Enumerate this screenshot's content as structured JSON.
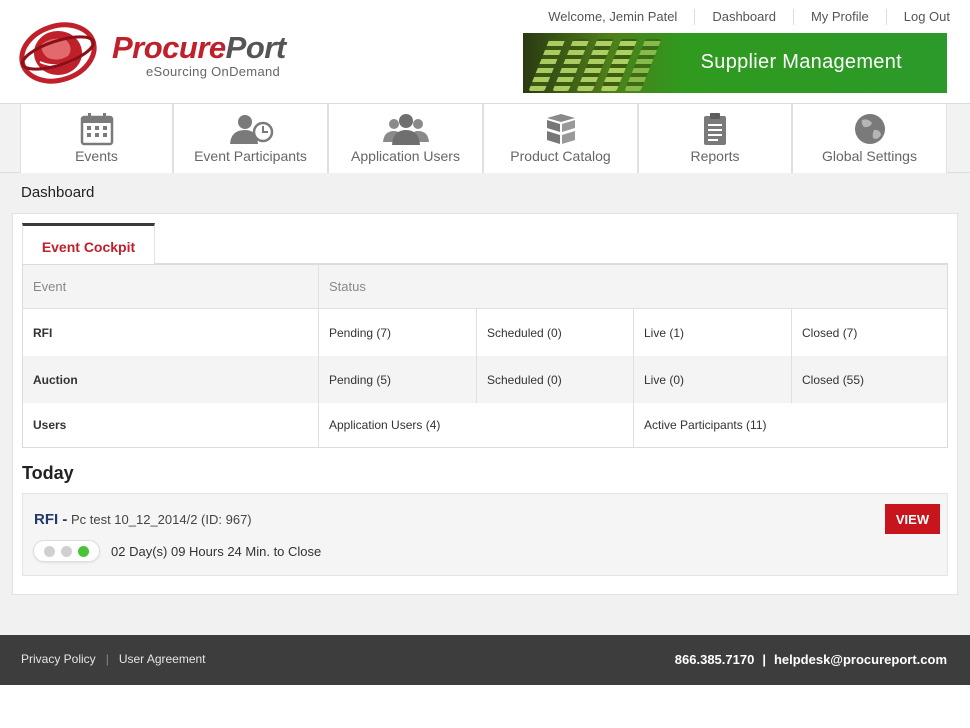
{
  "brand": {
    "name_part1": "Procure",
    "name_part2": "Port",
    "tagline": "eSourcing OnDemand",
    "accent": "#c0202a"
  },
  "top_links": {
    "welcome": "Welcome, Jemin Patel",
    "dashboard": "Dashboard",
    "my_profile": "My Profile",
    "log_out": "Log Out"
  },
  "banner": {
    "text": "Supplier Management"
  },
  "nav": [
    {
      "label": "Events",
      "icon": "calendar-icon"
    },
    {
      "label": "Event Participants",
      "icon": "participants-clock-icon"
    },
    {
      "label": "Application Users",
      "icon": "users-group-icon"
    },
    {
      "label": "Product Catalog",
      "icon": "boxes-icon"
    },
    {
      "label": "Reports",
      "icon": "clipboard-icon"
    },
    {
      "label": "Global Settings",
      "icon": "globe-icon"
    }
  ],
  "breadcrumb": "Dashboard",
  "tabs": {
    "active": "Event Cockpit"
  },
  "cockpit": {
    "headers": {
      "event": "Event",
      "status": "Status"
    },
    "rows": [
      {
        "label": "RFI",
        "cells": [
          "Pending (7)",
          "Scheduled (0)",
          "Live (1)",
          "Closed (7)"
        ]
      },
      {
        "label": "Auction",
        "cells": [
          "Pending (5)",
          "Scheduled (0)",
          "Live (0)",
          "Closed (55)"
        ]
      },
      {
        "label": "Users",
        "cells": [
          "Application Users (4)",
          "Active Participants (11)"
        ]
      }
    ]
  },
  "today": {
    "heading": "Today",
    "event": {
      "type": "RFI -",
      "name": "Pc test 10_12_2014/2 (ID: 967)",
      "time_left": "02 Day(s) 09 Hours 24 Min. to Close",
      "view_label": "VIEW",
      "status_color": "#4cc23a"
    }
  },
  "footer": {
    "privacy": "Privacy Policy",
    "agreement": "User Agreement",
    "phone": "866.385.7170",
    "email": "helpdesk@procureport.com"
  }
}
